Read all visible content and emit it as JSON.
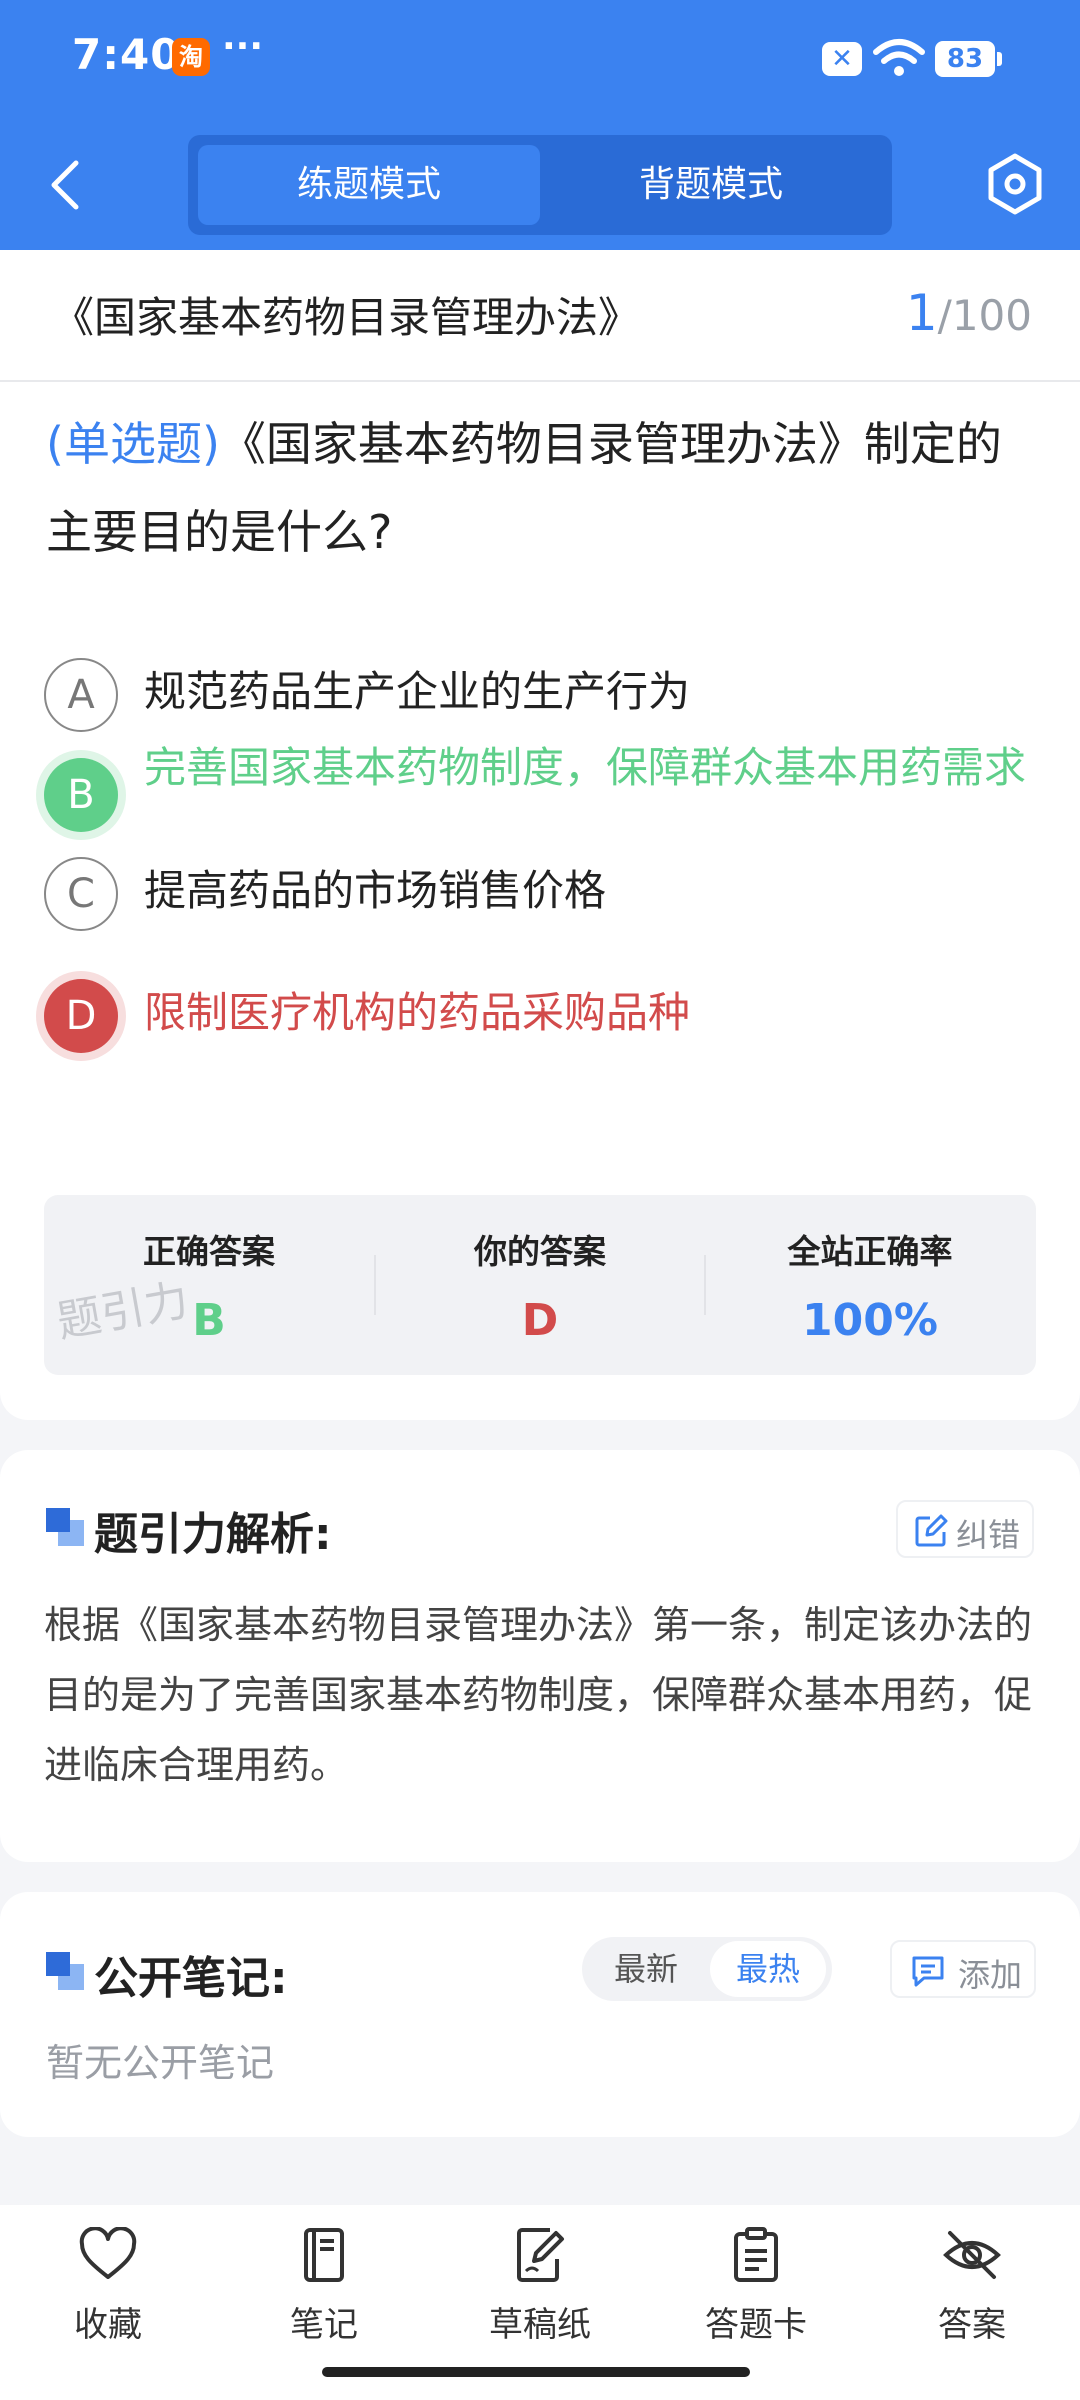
{
  "status_bar": {
    "time": "7:40",
    "app_badge": "淘",
    "more": "···",
    "notification_x": "✕",
    "battery": "83"
  },
  "header": {
    "mode_tabs": [
      {
        "label": "练题模式",
        "active": true
      },
      {
        "label": "背题模式",
        "active": false
      }
    ],
    "icons": {
      "back": "chevron-left-icon",
      "settings": "hexagon-settings-icon"
    }
  },
  "question": {
    "book_title": "《国家基本药物目录管理办法》",
    "counter_current": "1",
    "counter_total": "/100",
    "type": "(单选题)",
    "stem": "《国家基本药物目录管理办法》制定的主要目的是什么?",
    "options": [
      {
        "letter": "A",
        "text": "规范药品生产企业的生产行为",
        "state": "normal"
      },
      {
        "letter": "B",
        "text": "完善国家基本药物制度，保障群众基本用药需求",
        "state": "correct"
      },
      {
        "letter": "C",
        "text": "提高药品的市场销售价格",
        "state": "normal"
      },
      {
        "letter": "D",
        "text": "限制医疗机构的药品采购品种",
        "state": "wrong"
      }
    ]
  },
  "result": {
    "correct_label": "正确答案",
    "correct_value": "B",
    "yours_label": "你的答案",
    "yours_value": "D",
    "rate_label": "全站正确率",
    "rate_value": "100%",
    "watermark": "题引力"
  },
  "analysis": {
    "title": "题引力解析:",
    "correction_label": "纠错",
    "body": "根据《国家基本药物目录管理办法》第一条，制定该办法的目的是为了完善国家基本药物制度，保障群众基本用药，促进临床合理用药。"
  },
  "notes": {
    "title": "公开笔记:",
    "sort_latest": "最新",
    "sort_hot": "最热",
    "sort_selected": "最热",
    "add_label": "添加",
    "empty_text": "暂无公开笔记"
  },
  "bottom_nav": [
    {
      "label": "收藏",
      "icon": "heart-icon"
    },
    {
      "label": "笔记",
      "icon": "notebook-icon"
    },
    {
      "label": "草稿纸",
      "icon": "draft-paper-icon"
    },
    {
      "label": "答题卡",
      "icon": "answer-card-icon"
    },
    {
      "label": "答案",
      "icon": "eye-off-icon"
    }
  ],
  "colors": {
    "primary": "#3b82f0",
    "correct": "#5fcf8a",
    "wrong": "#d24b4b"
  }
}
